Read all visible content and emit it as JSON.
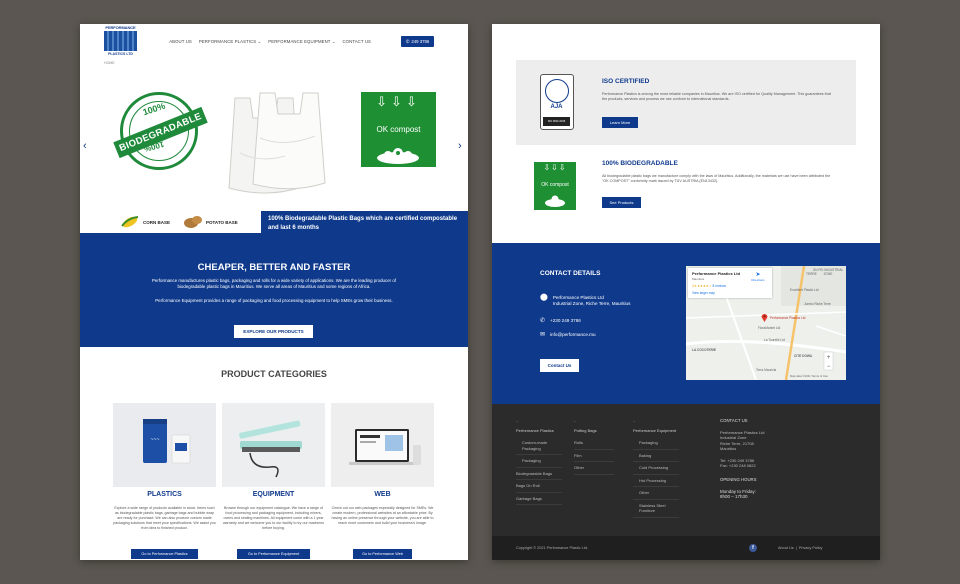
{
  "brand": {
    "name": "PERFORMANCE",
    "sub": "PLASTICS LTD"
  },
  "nav": {
    "items": [
      "ABOUT US",
      "PERFORMANCE PLASTICS ⌄",
      "PERFORMANCE EQUIPMENT ⌄",
      "CONTACT US"
    ],
    "phone": "249 3786"
  },
  "breadcrumb": "HOME",
  "slider": {
    "badge_top": "100%",
    "badge_band": "BIODEGRADABLE",
    "badge_bottom": "100%",
    "compost_text": "OK compost",
    "crops": [
      "CORN BASE",
      "POTATO BASE"
    ],
    "banner": "100% Biodegradable Plastic Bags which are certified compostable and last 6 months",
    "prev_arrow": "‹",
    "next_arrow": "›"
  },
  "hero": {
    "title": "CHEAPER, BETTER AND FASTER",
    "para1": "Performance manufactures plastic bags, packaging and rolls for a wide variety of applications. We are the leading producer of biodegradable plastic bags in Mauritius. We serve all areas of Mauritius and some regions of Africa.",
    "para2": "Performance Equipment provides a range of packaging and food processing equipment to help SMEs grow their business.",
    "cta": "EXPLORE OUR PRODUCTS"
  },
  "categories": {
    "title": "PRODUCT CATEGORIES",
    "items": [
      {
        "name": "PLASTICS",
        "desc": "Explore a wide range of products available in stock. Items such as biodegradable plastic bags, garbage bags and bubble wrap are ready for purchase. We can also produce custom made packaging solutions that meet your specifications. We assist you from idea to finished product.",
        "button": "Go to Performance Plastics"
      },
      {
        "name": "EQUIPMENT",
        "desc": "Browse through our equipment catalogue. We have a range of food processing and packaging equipment, including mixers, ovens and sealing machines. All equipment come with a 1 year warranty and we welcome you to our facility to try our machines before buying.",
        "button": "Go to Performance Equipment"
      },
      {
        "name": "WEB",
        "desc": "Check out our web packages especially designed for SMEs. We create modern, professional websites at an affordable price. By having an online presence through your website, you are able to reach more customers and build your business's image.",
        "button": "Go to Performance Web"
      }
    ]
  },
  "iso": {
    "logo_text": "AJA",
    "logo_sub": "ISO 9001:2015",
    "title": "ISO CERTIFIED",
    "body": "Performance Plastics is among the most reliable companies in Mauritius. We are ISO certified for Quality Management. This guarantees that the products, services and process we use conform to international standards.",
    "button": "Learn More"
  },
  "bio": {
    "compost_text": "OK compost",
    "title": "100% BIODEGRADABLE",
    "body": "All biodegradable plastic bags we manufacture comply with the laws of Mauritius. Additionally, the materials we use have been attributed the \"OK COMPOST\" conformity mark issued by TÜV AUSTRIA (EN13432).",
    "button": "See Products"
  },
  "contact": {
    "title": "CONTACT DETAILS",
    "company": "Performance Plastics Ltd",
    "address": "Industrial Zone, Riche Terre, Mauritius",
    "phone": "+230 249 3786",
    "email": "info@performance.mu",
    "button": "Contact Us"
  },
  "map": {
    "name": "Performance Plastics Ltd",
    "sub": "Mauritius",
    "rating": "3.4 ★★★★☆",
    "reviews": "8 reviews",
    "link": "View larger map",
    "directions": "Directions",
    "pin_label": "Performance Plastics Ltd",
    "labels": [
      "TERRE",
      "JIN FEI INDUSTRIAL ZONE",
      "Excellent Plastic Ltd",
      "Jumbo Riche Terre",
      "FloraMarket Ltd",
      "La Tourelle Ltd",
      "LA COCOTERIE",
      "CITE DOWA",
      "Terra Mauricia"
    ],
    "footer": "Map data ©2021   Terms of Use"
  },
  "footer": {
    "col1": {
      "head": "Performance Plastics",
      "items": [
        "Custom-made Packaging",
        "Packaging",
        "Biodegradable Bags",
        "Bags On Roll",
        "Garbage Bags"
      ]
    },
    "col2": {
      "head": "Potting Bags",
      "items": [
        "Rolls",
        "Film",
        "Other"
      ]
    },
    "col3": {
      "head": "Performance Equipment",
      "items": [
        "Packaging",
        "Baking",
        "Cold Processing",
        "Hot Processing",
        "Other",
        "Stainless Steel Furniture"
      ]
    },
    "contact_head": "CONTACT US",
    "contact_lines": [
      "Performance Plastics Ltd",
      "Industrial Zone",
      "Riche Terre, 21708",
      "Mauritius"
    ],
    "tel": "Tel: +230 249 3786",
    "fax": "Fax: +230 248 0822",
    "hours_head": "OPENING HOURS",
    "hours_days": "Monday to Friday:",
    "hours_time": "8h00 – 17h30"
  },
  "bottom": {
    "copyright": "Copyright © 2021 Performance Plastic Ltd.",
    "links": "About Us  |  Privacy Policy"
  },
  "colors": {
    "brand_blue": "#0f3a8c",
    "compost_green": "#1f8f33",
    "footer_dark": "#2b2b2b"
  }
}
